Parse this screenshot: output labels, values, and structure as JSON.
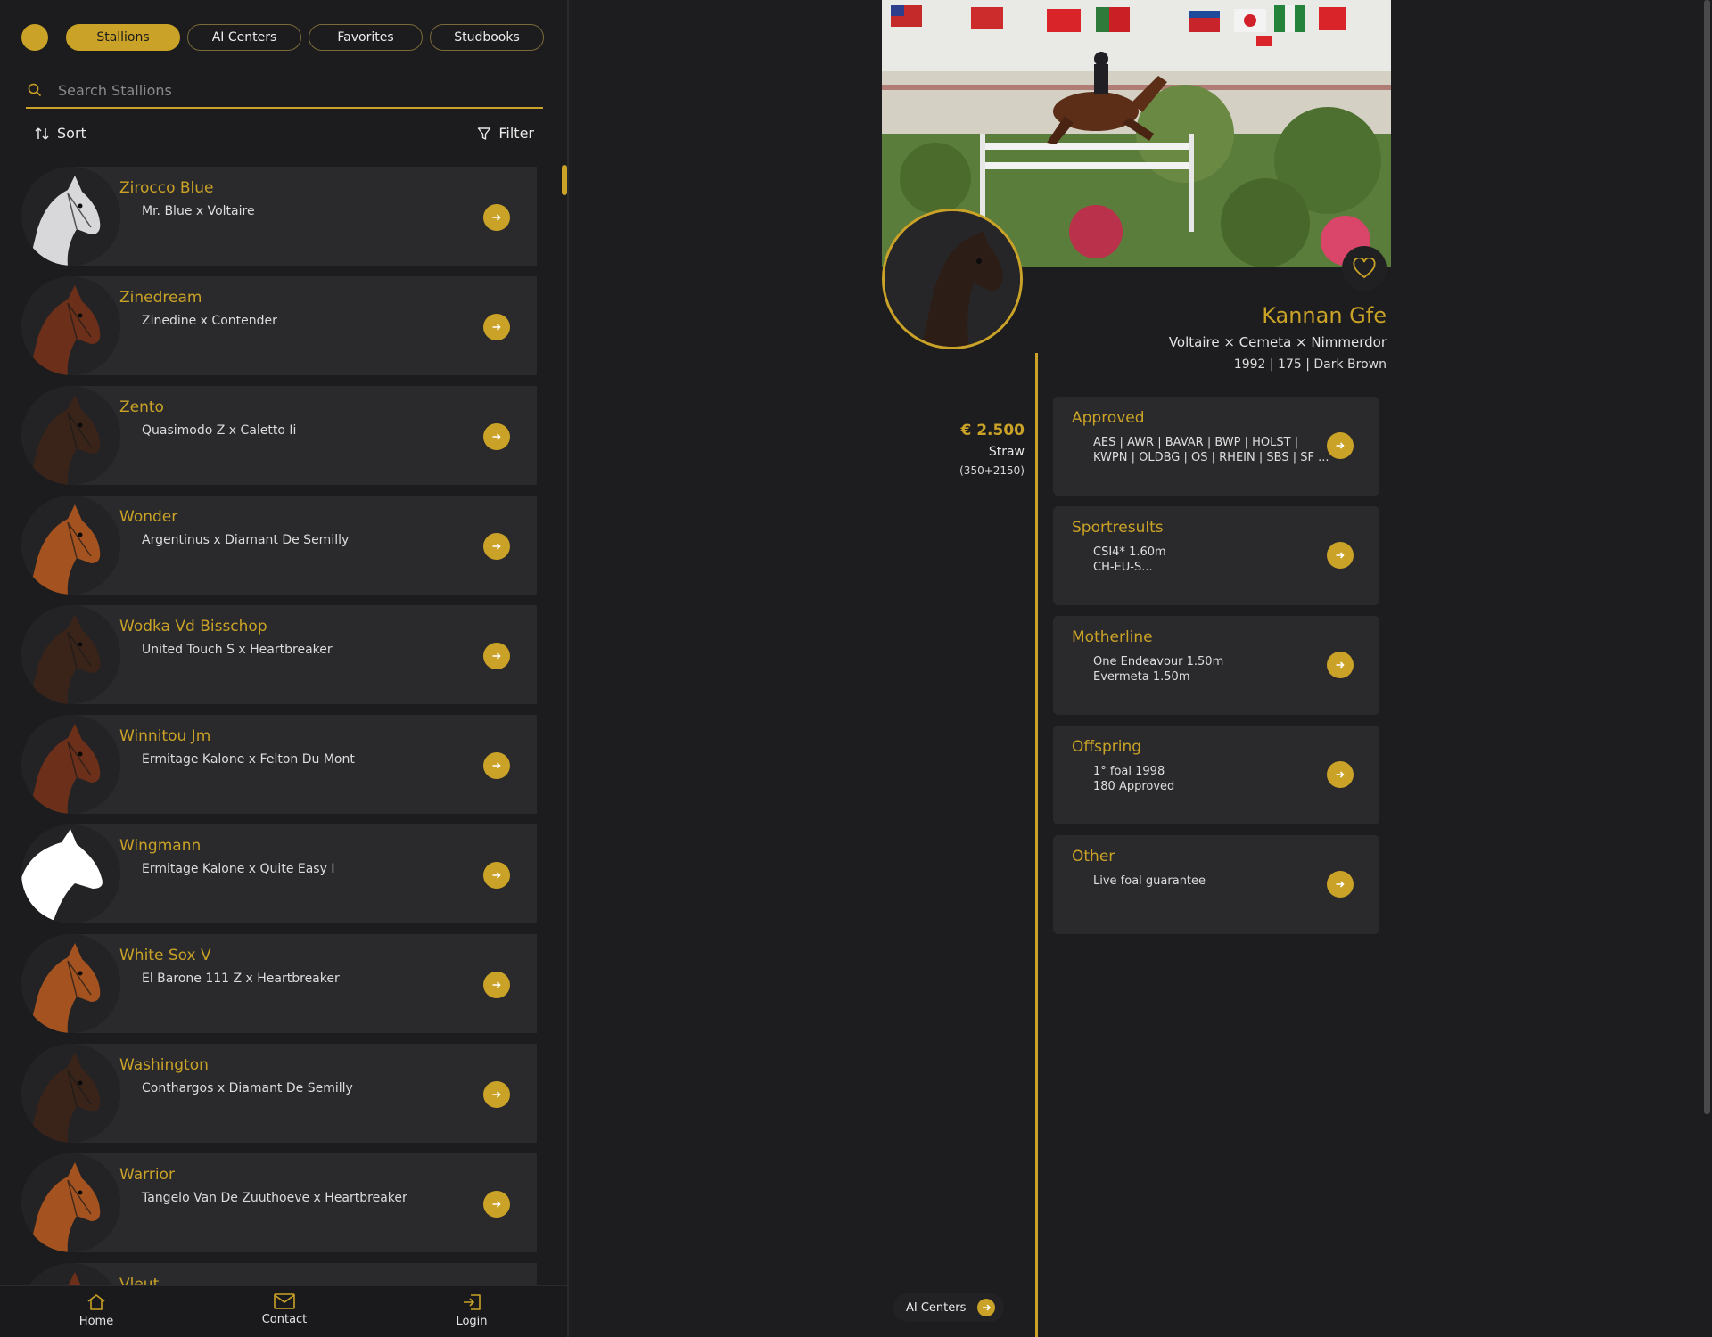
{
  "nav": {
    "tabs": [
      {
        "label": "Stallions",
        "active": true
      },
      {
        "label": "AI Centers",
        "active": false
      },
      {
        "label": "Favorites",
        "active": false
      },
      {
        "label": "Studbooks",
        "active": false
      }
    ]
  },
  "search": {
    "placeholder": "Search Stallions",
    "value": ""
  },
  "toolbar": {
    "sort_label": "Sort",
    "filter_label": "Filter"
  },
  "stallions": [
    {
      "name": "Zirocco Blue",
      "pedigree": "Mr. Blue x Voltaire",
      "coat": "grey"
    },
    {
      "name": "Zinedream",
      "pedigree": "Zinedine x Contender",
      "coat": "bay"
    },
    {
      "name": "Zento",
      "pedigree": "Quasimodo Z x Caletto Ii",
      "coat": "darkbay"
    },
    {
      "name": "Wonder",
      "pedigree": "Argentinus x Diamant De Semilly",
      "coat": "chestnut"
    },
    {
      "name": "Wodka Vd Bisschop",
      "pedigree": "United Touch S x Heartbreaker",
      "coat": "darkbay"
    },
    {
      "name": "Winnitou Jm",
      "pedigree": "Ermitage Kalone x Felton Du Mont",
      "coat": "bay"
    },
    {
      "name": "Wingmann",
      "pedigree": "Ermitage Kalone x Quite Easy I",
      "coat": "placeholder"
    },
    {
      "name": "White Sox V",
      "pedigree": "El Barone 111 Z x Heartbreaker",
      "coat": "chestnut"
    },
    {
      "name": "Washington",
      "pedigree": "Conthargos x Diamant De Semilly",
      "coat": "darkbay"
    },
    {
      "name": "Warrior",
      "pedigree": "Tangelo Van De Zuuthoeve x Heartbreaker",
      "coat": "chestnut"
    },
    {
      "name": "Vleut",
      "pedigree": "",
      "coat": "bay"
    }
  ],
  "bottom_nav": [
    {
      "label": "Home",
      "icon": "home-icon"
    },
    {
      "label": "Contact",
      "icon": "mail-icon"
    },
    {
      "label": "Login",
      "icon": "login-icon"
    }
  ],
  "detail": {
    "name": "Kannan Gfe",
    "pedigree": "Voltaire × Cemeta × Nimmerdor",
    "meta": "1992 | 175 | Dark Brown",
    "price": "€ 2.500",
    "unit": "Straw",
    "unit_note": "(350+2150)",
    "sections": [
      {
        "title": "Approved",
        "lines": [
          "AES | AWR | BAVAR | BWP | HOLST |",
          "KWPN | OLDBG | OS | RHEIN | SBS | SF ..."
        ]
      },
      {
        "title": "Sportresults",
        "lines": [
          "CSI4* 1.60m",
          "CH-EU-S..."
        ]
      },
      {
        "title": "Motherline",
        "lines": [
          "One Endeavour 1.50m",
          "Evermeta 1.50m"
        ]
      },
      {
        "title": "Offspring",
        "lines": [
          "1° foal 1998",
          "180 Approved"
        ]
      },
      {
        "title": "Other",
        "lines": [
          "Live foal guarantee"
        ]
      }
    ],
    "ai_centers_label": "AI Centers"
  },
  "colors": {
    "accent": "#c9a227",
    "background": "#1d1d1f",
    "card": "#2a2a2c"
  }
}
